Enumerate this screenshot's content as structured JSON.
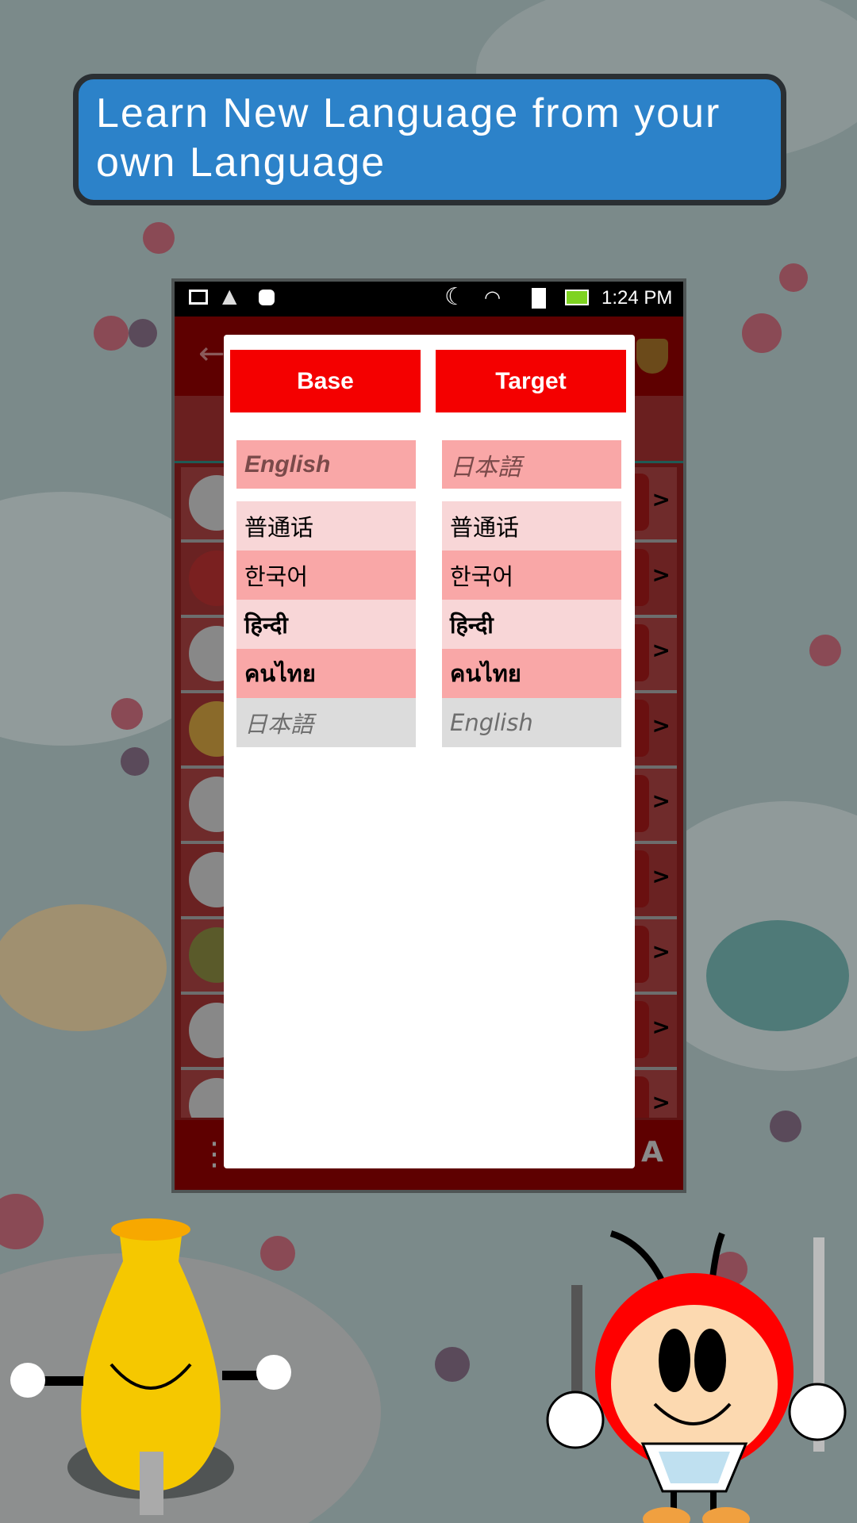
{
  "banner": {
    "text": "Learn New Language from your own Language"
  },
  "status_bar": {
    "time": "1:24 PM",
    "icons": [
      "image-icon",
      "warning-icon",
      "android-icon",
      "moon-icon",
      "wifi-icon",
      "sd-card-icon",
      "battery-charging-icon"
    ],
    "battery_color": "#7ed321"
  },
  "dialog": {
    "base_label": "Base",
    "target_label": "Target",
    "base": {
      "selected": "English",
      "options": [
        "普通话",
        "한국어",
        "हिन्दी",
        "คนไทย",
        "日本語"
      ]
    },
    "target": {
      "selected": "日本語",
      "options": [
        "普通话",
        "한국어",
        "हिन्दी",
        "คนไทย",
        "English"
      ]
    }
  },
  "colors": {
    "accent": "#f40000",
    "banner": "#2c82c9",
    "selected_bg": "#f9a7a7",
    "alt_bg": "#f8d6d7",
    "disabled_bg": "#dcdcdc"
  },
  "list": {
    "chevron": ">"
  }
}
